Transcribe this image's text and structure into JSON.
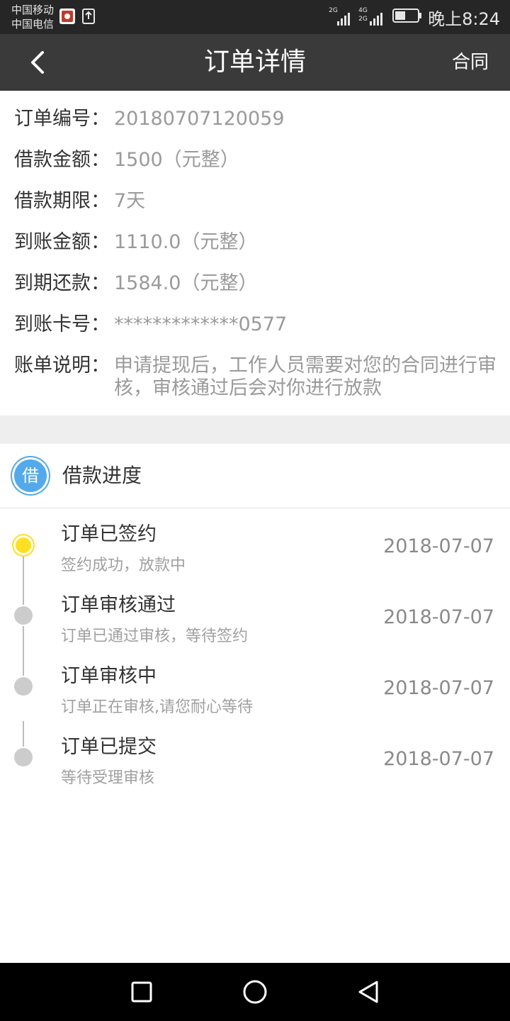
{
  "status_bar": {
    "carrier1": "中国移动",
    "carrier2": "中国电信",
    "signal1_label": "2G",
    "signal2_label_top": "4G",
    "signal2_label_bottom": "2G",
    "time": "晚上8:24"
  },
  "header": {
    "title": "订单详情",
    "contract_label": "合同"
  },
  "order": {
    "fields": [
      {
        "label": "订单编号：",
        "value": "20180707120059"
      },
      {
        "label": "借款金额：",
        "value": "1500（元整）"
      },
      {
        "label": "借款期限：",
        "value": "7天"
      },
      {
        "label": "到账金额：",
        "value": "1110.0（元整）"
      },
      {
        "label": "到期还款：",
        "value": "1584.0（元整）"
      },
      {
        "label": "到账卡号：",
        "value": "*************0577"
      },
      {
        "label": "账单说明：",
        "value": "申请提现后，工作人员需要对您的合同进行审核，审核通过后会对你进行放款"
      }
    ]
  },
  "progress": {
    "badge": "借",
    "title": "借款进度",
    "steps": [
      {
        "title": "订单已签约",
        "subtitle": "签约成功，放款中",
        "date": "2018-07-07"
      },
      {
        "title": "订单审核通过",
        "subtitle": "订单已通过审核，等待签约",
        "date": "2018-07-07"
      },
      {
        "title": "订单审核中",
        "subtitle": "订单正在审核,请您耐心等待",
        "date": "2018-07-07"
      },
      {
        "title": "订单已提交",
        "subtitle": "等待受理审核",
        "date": "2018-07-07"
      }
    ]
  },
  "colors": {
    "title_bar": "#3a3a3a",
    "status_bar": "#262626",
    "badge_blue": "#54a9ea",
    "active_dot": "#ffdf22"
  }
}
